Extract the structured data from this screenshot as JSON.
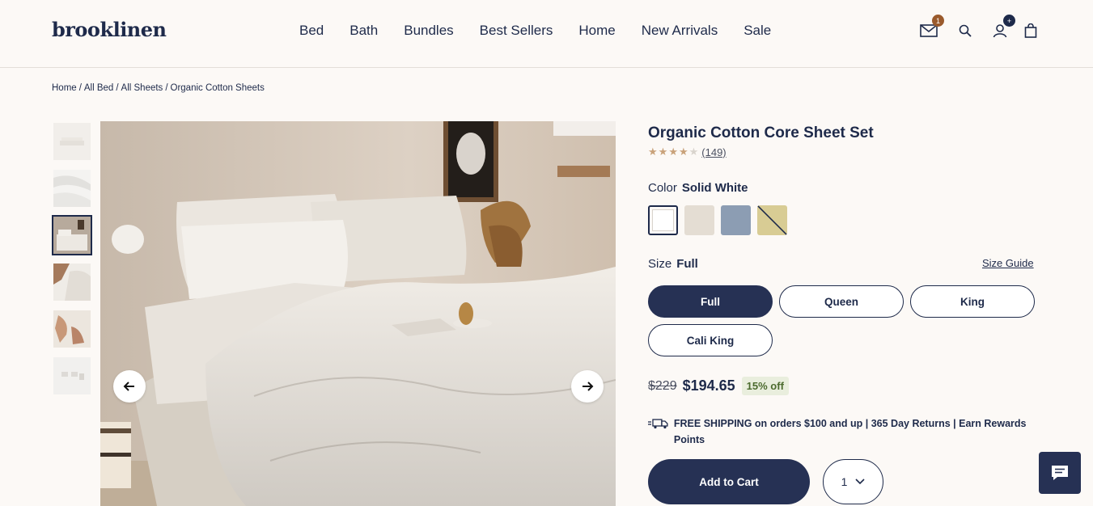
{
  "header": {
    "logo": "brooklinen",
    "nav": [
      "Bed",
      "Bath",
      "Bundles",
      "Best Sellers",
      "Home",
      "New Arrivals",
      "Sale"
    ],
    "icons": {
      "mail": {
        "name": "mail-icon",
        "badge": "1",
        "badge_color": "#9a5a2c"
      },
      "search": {
        "name": "search-icon"
      },
      "account": {
        "name": "account-icon",
        "badge": "+",
        "badge_color": "#1e2a4a"
      },
      "cart": {
        "name": "bag-icon"
      }
    }
  },
  "breadcrumb": [
    "Home",
    "All Bed",
    "All Sheets",
    "Organic Cotton Sheets"
  ],
  "gallery": {
    "thumbnail_count": 6,
    "active_thumbnail": 3
  },
  "product": {
    "title": "Organic Cotton Core Sheet Set",
    "rating": 4,
    "rating_max": 5,
    "reviews": "(149)",
    "color_label": "Color",
    "color_value": "Solid White",
    "swatches": [
      {
        "name": "Solid White",
        "color": "#ffffff",
        "selected": true
      },
      {
        "name": "Cream",
        "color": "#e4ddd3",
        "selected": false
      },
      {
        "name": "Blue",
        "color": "#8c9db3",
        "selected": false
      },
      {
        "name": "Striped",
        "color": "#d8cc94",
        "selected": false
      }
    ],
    "size_label": "Size",
    "size_value": "Full",
    "size_guide": "Size Guide",
    "sizes": [
      "Full",
      "Queen",
      "King",
      "Cali King"
    ],
    "old_price": "$229",
    "price": "$194.65",
    "discount": "15% off",
    "shipping": "FREE SHIPPING on orders $100 and up | 365 Day Returns | Earn Rewards Points",
    "add_to_cart": "Add to Cart",
    "quantity": "1"
  },
  "colors": {
    "navy": "#263154",
    "text": "#1e2a4a",
    "background": "#fcf9f6",
    "star": "#c9a27a"
  }
}
